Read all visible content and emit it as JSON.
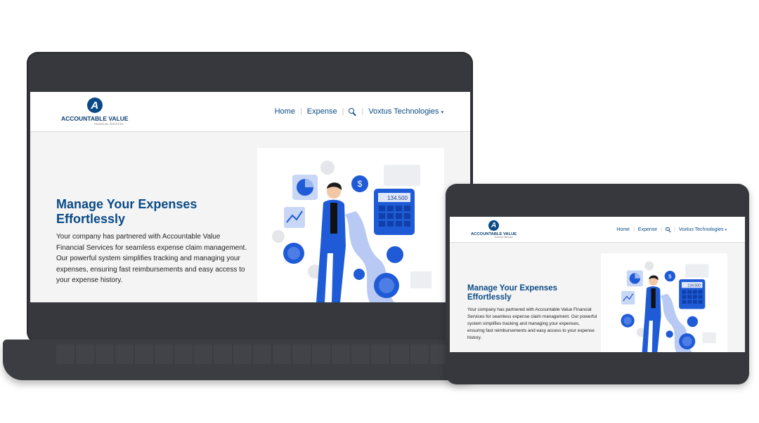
{
  "brand": {
    "name": "ACCOUNTABLE VALUE",
    "tagline": "FINANCIAL SERVICES"
  },
  "nav": {
    "home": "Home",
    "expense": "Expense",
    "company": "Voxtus Technologies",
    "search_icon": "search-icon",
    "dropdown_icon": "caret-down-icon"
  },
  "hero": {
    "title": "Manage Your Expenses Effortlessly",
    "body": "Your company has partnered with Accountable Value Financial Services for seamless expense claim management. Our powerful system simplifies tracking and managing your expenses, ensuring fast reimbursements and easy access to your expense history."
  },
  "illustration": {
    "calculator_display": "134.500",
    "coin_symbol": "$"
  },
  "colors": {
    "brand_blue": "#0a4a86",
    "illustration_blue": "#1f5bd6",
    "device_frame": "#36383d"
  }
}
